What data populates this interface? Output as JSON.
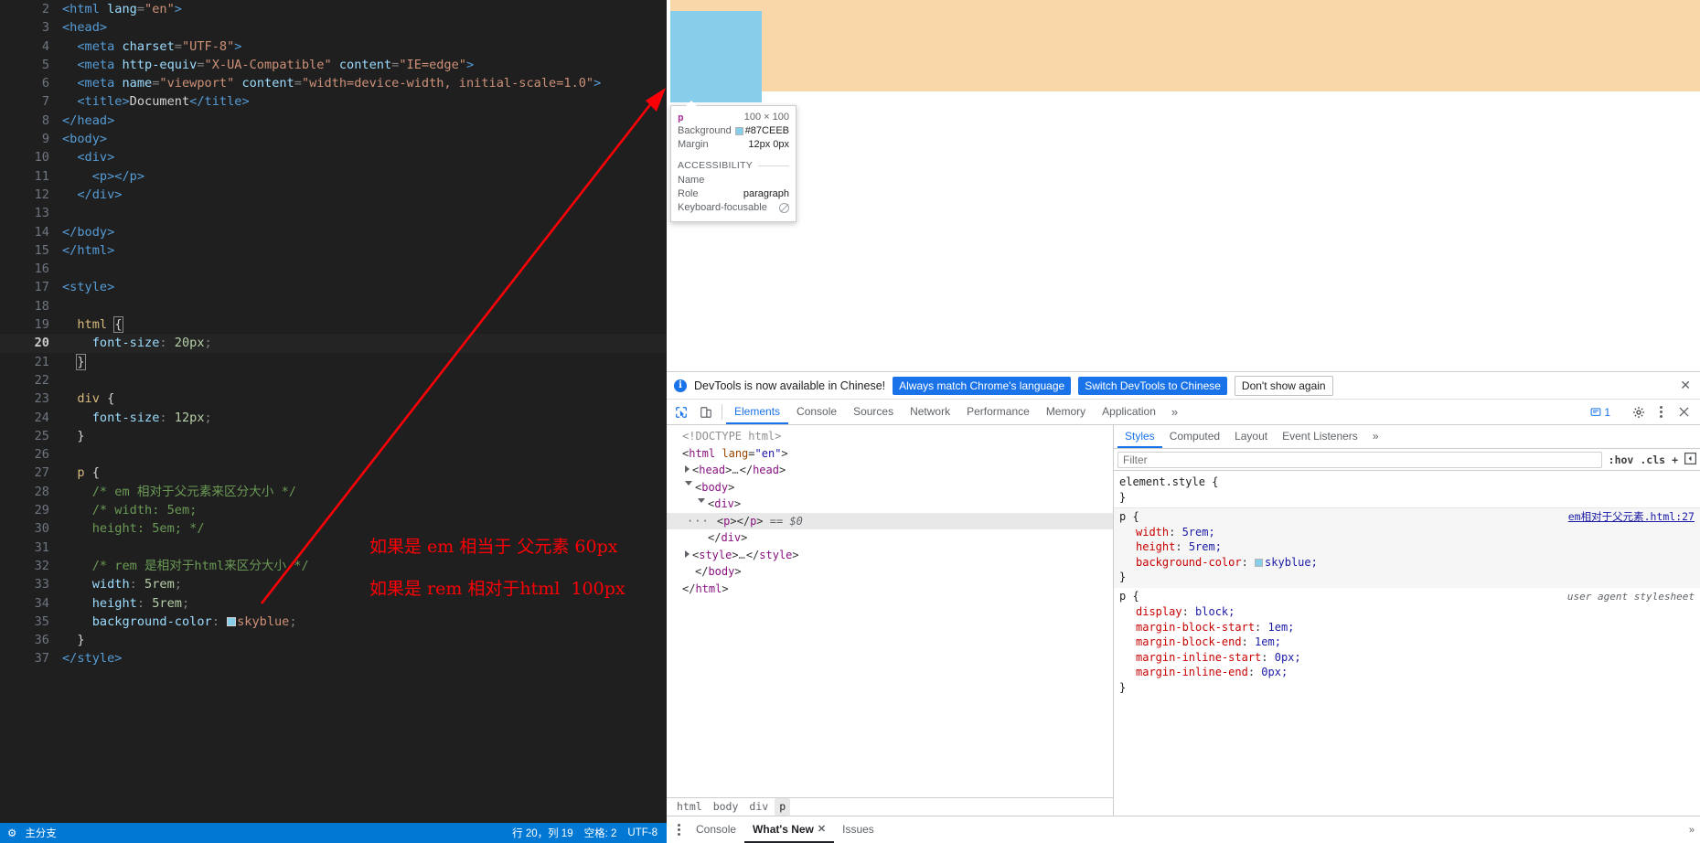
{
  "editor": {
    "lines": [
      {
        "n": 2,
        "tokens": [
          {
            "t": "tag",
            "v": "<html "
          },
          {
            "t": "attr",
            "v": "lang"
          },
          {
            "t": "punct",
            "v": "="
          },
          {
            "t": "str",
            "v": "\"en\""
          },
          {
            "t": "tag",
            "v": ">"
          }
        ]
      },
      {
        "n": 3,
        "tokens": [
          {
            "t": "tag",
            "v": "<head>"
          }
        ]
      },
      {
        "n": 4,
        "tokens": [
          {
            "t": "plain",
            "v": "  "
          },
          {
            "t": "tag",
            "v": "<meta "
          },
          {
            "t": "attr",
            "v": "charset"
          },
          {
            "t": "punct",
            "v": "="
          },
          {
            "t": "str",
            "v": "\"UTF-8\""
          },
          {
            "t": "tag",
            "v": ">"
          }
        ]
      },
      {
        "n": 5,
        "tokens": [
          {
            "t": "plain",
            "v": "  "
          },
          {
            "t": "tag",
            "v": "<meta "
          },
          {
            "t": "attr",
            "v": "http-equiv"
          },
          {
            "t": "punct",
            "v": "="
          },
          {
            "t": "str",
            "v": "\"X-UA-Compatible\""
          },
          {
            "t": "plain",
            "v": " "
          },
          {
            "t": "attr",
            "v": "content"
          },
          {
            "t": "punct",
            "v": "="
          },
          {
            "t": "str",
            "v": "\"IE=edge\""
          },
          {
            "t": "tag",
            "v": ">"
          }
        ]
      },
      {
        "n": 6,
        "tokens": [
          {
            "t": "plain",
            "v": "  "
          },
          {
            "t": "tag",
            "v": "<meta "
          },
          {
            "t": "attr",
            "v": "name"
          },
          {
            "t": "punct",
            "v": "="
          },
          {
            "t": "str",
            "v": "\"viewport\""
          },
          {
            "t": "plain",
            "v": " "
          },
          {
            "t": "attr",
            "v": "content"
          },
          {
            "t": "punct",
            "v": "="
          },
          {
            "t": "str",
            "v": "\"width=device-width, initial-scale=1.0\""
          },
          {
            "t": "tag",
            "v": ">"
          }
        ]
      },
      {
        "n": 7,
        "tokens": [
          {
            "t": "plain",
            "v": "  "
          },
          {
            "t": "tag",
            "v": "<title>"
          },
          {
            "t": "text",
            "v": "Document"
          },
          {
            "t": "tag",
            "v": "</title>"
          }
        ]
      },
      {
        "n": 8,
        "tokens": [
          {
            "t": "tag",
            "v": "</head>"
          }
        ]
      },
      {
        "n": 9,
        "tokens": [
          {
            "t": "tag",
            "v": "<body>"
          }
        ]
      },
      {
        "n": 10,
        "tokens": [
          {
            "t": "plain",
            "v": "  "
          },
          {
            "t": "tag",
            "v": "<div>"
          }
        ]
      },
      {
        "n": 11,
        "tokens": [
          {
            "t": "plain",
            "v": "    "
          },
          {
            "t": "tag",
            "v": "<p></p>"
          }
        ]
      },
      {
        "n": 12,
        "tokens": [
          {
            "t": "plain",
            "v": "  "
          },
          {
            "t": "tag",
            "v": "</div>"
          }
        ]
      },
      {
        "n": 13,
        "tokens": []
      },
      {
        "n": 14,
        "tokens": [
          {
            "t": "tag",
            "v": "</body>"
          }
        ]
      },
      {
        "n": 15,
        "tokens": [
          {
            "t": "tag",
            "v": "</html>"
          }
        ]
      },
      {
        "n": 16,
        "tokens": []
      },
      {
        "n": 17,
        "tokens": [
          {
            "t": "tag",
            "v": "<style>"
          }
        ]
      },
      {
        "n": 18,
        "tokens": []
      },
      {
        "n": 19,
        "tokens": [
          {
            "t": "plain",
            "v": "  "
          },
          {
            "t": "sel",
            "v": "html"
          },
          {
            "t": "plain",
            "v": " "
          },
          {
            "t": "brace-box",
            "v": "{"
          }
        ]
      },
      {
        "n": 20,
        "tokens": [
          {
            "t": "plain",
            "v": "    "
          },
          {
            "t": "prop",
            "v": "font-size"
          },
          {
            "t": "punct2",
            "v": ": "
          },
          {
            "t": "val",
            "v": "20px"
          },
          {
            "t": "punct2",
            "v": ";"
          }
        ],
        "active": true
      },
      {
        "n": 21,
        "tokens": [
          {
            "t": "plain",
            "v": "  "
          },
          {
            "t": "brace-box",
            "v": "}"
          }
        ]
      },
      {
        "n": 22,
        "tokens": []
      },
      {
        "n": 23,
        "tokens": [
          {
            "t": "plain",
            "v": "  "
          },
          {
            "t": "sel",
            "v": "div"
          },
          {
            "t": "plain",
            "v": " "
          },
          {
            "t": "brace",
            "v": "{"
          }
        ]
      },
      {
        "n": 24,
        "tokens": [
          {
            "t": "plain",
            "v": "    "
          },
          {
            "t": "prop",
            "v": "font-size"
          },
          {
            "t": "punct2",
            "v": ": "
          },
          {
            "t": "val",
            "v": "12px"
          },
          {
            "t": "punct2",
            "v": ";"
          }
        ]
      },
      {
        "n": 25,
        "tokens": [
          {
            "t": "plain",
            "v": "  "
          },
          {
            "t": "brace",
            "v": "}"
          }
        ]
      },
      {
        "n": 26,
        "tokens": []
      },
      {
        "n": 27,
        "tokens": [
          {
            "t": "plain",
            "v": "  "
          },
          {
            "t": "sel",
            "v": "p"
          },
          {
            "t": "plain",
            "v": " "
          },
          {
            "t": "brace",
            "v": "{"
          }
        ]
      },
      {
        "n": 28,
        "tokens": [
          {
            "t": "plain",
            "v": "    "
          },
          {
            "t": "com",
            "v": "/* em 相对于父元素来区分大小 */"
          }
        ]
      },
      {
        "n": 29,
        "tokens": [
          {
            "t": "plain",
            "v": "    "
          },
          {
            "t": "com",
            "v": "/* width: 5em;"
          }
        ]
      },
      {
        "n": 30,
        "tokens": [
          {
            "t": "plain",
            "v": "    "
          },
          {
            "t": "com",
            "v": "height: 5em; */"
          }
        ]
      },
      {
        "n": 31,
        "tokens": []
      },
      {
        "n": 32,
        "tokens": [
          {
            "t": "plain",
            "v": "    "
          },
          {
            "t": "com",
            "v": "/* rem 是相对于html来区分大小 */"
          }
        ]
      },
      {
        "n": 33,
        "tokens": [
          {
            "t": "plain",
            "v": "    "
          },
          {
            "t": "prop",
            "v": "width"
          },
          {
            "t": "punct2",
            "v": ": "
          },
          {
            "t": "val",
            "v": "5rem"
          },
          {
            "t": "punct2",
            "v": ";"
          }
        ]
      },
      {
        "n": 34,
        "tokens": [
          {
            "t": "plain",
            "v": "    "
          },
          {
            "t": "prop",
            "v": "height"
          },
          {
            "t": "punct2",
            "v": ": "
          },
          {
            "t": "val",
            "v": "5rem"
          },
          {
            "t": "punct2",
            "v": ";"
          }
        ]
      },
      {
        "n": 35,
        "tokens": [
          {
            "t": "plain",
            "v": "    "
          },
          {
            "t": "prop",
            "v": "background-color"
          },
          {
            "t": "punct2",
            "v": ": "
          },
          {
            "t": "swatch",
            "v": ""
          },
          {
            "t": "str",
            "v": "skyblue"
          },
          {
            "t": "punct2",
            "v": ";"
          }
        ]
      },
      {
        "n": 36,
        "tokens": [
          {
            "t": "plain",
            "v": "  "
          },
          {
            "t": "brace",
            "v": "}"
          }
        ]
      },
      {
        "n": 37,
        "tokens": [
          {
            "t": "tag",
            "v": "</style>"
          }
        ]
      }
    ],
    "annotations": [
      {
        "id": "annot1",
        "text": "如果是 em 相当于 父元素 60px"
      },
      {
        "id": "annot2",
        "text": "如果是 rem 相对于html  100px"
      }
    ],
    "statusbar": {
      "left": [
        "⚙",
        "主分支"
      ],
      "right": [
        "行 20，列 19",
        "空格: 2",
        "UTF-8"
      ]
    }
  },
  "browser": {
    "page": {
      "div_bg_color": "#fad7a9",
      "p_bg_color": "#87ceeb"
    },
    "inspect_tooltip": {
      "tag": "p",
      "dimensions": "100 × 100",
      "rows": [
        {
          "label": "Background",
          "value": "#87CEEB",
          "swatch": true
        },
        {
          "label": "Margin",
          "value": "12px 0px",
          "swatch": false
        }
      ],
      "section_title": "ACCESSIBILITY",
      "a11y": [
        {
          "label": "Name",
          "value": ""
        },
        {
          "label": "Role",
          "value": "paragraph"
        },
        {
          "label": "Keyboard-focusable",
          "value": "",
          "icon": "no-entry-icon"
        }
      ]
    }
  },
  "devtools": {
    "notice": {
      "message": "DevTools is now available in Chinese!",
      "btn_always": "Always match Chrome's language",
      "btn_switch": "Switch DevTools to Chinese",
      "btn_dismiss": "Don't show again",
      "close": "✕"
    },
    "tabs": [
      {
        "label": "Elements",
        "selected": true
      },
      {
        "label": "Console",
        "selected": false
      },
      {
        "label": "Sources",
        "selected": false
      },
      {
        "label": "Network",
        "selected": false
      },
      {
        "label": "Performance",
        "selected": false
      },
      {
        "label": "Memory",
        "selected": false
      },
      {
        "label": "Application",
        "selected": false
      }
    ],
    "tabs_overflow": "»",
    "message_count": "1",
    "dom": [
      {
        "indent": 0,
        "marker": "none",
        "tokens": [
          {
            "t": "doctype",
            "v": "<!DOCTYPE html>"
          }
        ]
      },
      {
        "indent": 0,
        "marker": "none",
        "tokens": [
          {
            "t": "punct",
            "v": "<"
          },
          {
            "t": "tag",
            "v": "html"
          },
          {
            "t": "plain",
            "v": " "
          },
          {
            "t": "attr",
            "v": "lang"
          },
          {
            "t": "punct",
            "v": "="
          },
          {
            "t": "val",
            "v": "\"en\""
          },
          {
            "t": "punct",
            "v": ">"
          }
        ]
      },
      {
        "indent": 1,
        "marker": "closed",
        "tokens": [
          {
            "t": "punct",
            "v": "<"
          },
          {
            "t": "tag",
            "v": "head"
          },
          {
            "t": "punct",
            "v": ">"
          },
          {
            "t": "dots",
            "v": "…"
          },
          {
            "t": "punct",
            "v": "</"
          },
          {
            "t": "tag",
            "v": "head"
          },
          {
            "t": "punct",
            "v": ">"
          }
        ]
      },
      {
        "indent": 1,
        "marker": "open",
        "tokens": [
          {
            "t": "punct",
            "v": "<"
          },
          {
            "t": "tag",
            "v": "body"
          },
          {
            "t": "punct",
            "v": ">"
          }
        ]
      },
      {
        "indent": 2,
        "marker": "open",
        "tokens": [
          {
            "t": "punct",
            "v": "<"
          },
          {
            "t": "tag",
            "v": "div"
          },
          {
            "t": "punct",
            "v": ">"
          }
        ]
      },
      {
        "indent": 3,
        "marker": "dots",
        "selected": true,
        "tokens": [
          {
            "t": "punct",
            "v": "<"
          },
          {
            "t": "tag",
            "v": "p"
          },
          {
            "t": "punct",
            "v": "></"
          },
          {
            "t": "tag",
            "v": "p"
          },
          {
            "t": "punct",
            "v": ">"
          },
          {
            "t": "plain",
            "v": " "
          },
          {
            "t": "dollar",
            "v": "== $0"
          }
        ]
      },
      {
        "indent": 2,
        "marker": "none",
        "tokens": [
          {
            "t": "punct",
            "v": "</"
          },
          {
            "t": "tag",
            "v": "div"
          },
          {
            "t": "punct",
            "v": ">"
          }
        ]
      },
      {
        "indent": 1,
        "marker": "closed",
        "tokens": [
          {
            "t": "punct",
            "v": "<"
          },
          {
            "t": "tag",
            "v": "style"
          },
          {
            "t": "punct",
            "v": ">"
          },
          {
            "t": "dots",
            "v": "…"
          },
          {
            "t": "punct",
            "v": "</"
          },
          {
            "t": "tag",
            "v": "style"
          },
          {
            "t": "punct",
            "v": ">"
          }
        ]
      },
      {
        "indent": 1,
        "marker": "none",
        "tokens": [
          {
            "t": "punct",
            "v": "</"
          },
          {
            "t": "tag",
            "v": "body"
          },
          {
            "t": "punct",
            "v": ">"
          }
        ]
      },
      {
        "indent": 0,
        "marker": "none",
        "tokens": [
          {
            "t": "punct",
            "v": "</"
          },
          {
            "t": "tag",
            "v": "html"
          },
          {
            "t": "punct",
            "v": ">"
          }
        ]
      }
    ],
    "breadcrumb": [
      "html",
      "body",
      "div",
      "p"
    ],
    "breadcrumb_selected": "p",
    "styles": {
      "tabs": [
        {
          "label": "Styles",
          "selected": true
        },
        {
          "label": "Computed",
          "selected": false
        },
        {
          "label": "Layout",
          "selected": false
        },
        {
          "label": "Event Listeners",
          "selected": false
        }
      ],
      "tabs_overflow": "»",
      "filter_placeholder": "Filter",
      "filter_value": "",
      "toolbar": [
        ":hov",
        ".cls",
        "+"
      ],
      "rules": [
        {
          "selector": "element.style {",
          "source": "",
          "declarations": [],
          "close": "}"
        },
        {
          "selector": "p {",
          "source": "em相对于父元素.html:27",
          "source_is_link": true,
          "highlight": true,
          "declarations": [
            {
              "name": "width",
              "value": "5rem;"
            },
            {
              "name": "height",
              "value": "5rem;"
            },
            {
              "name": "background-color",
              "value": "skyblue;",
              "swatch": true
            }
          ],
          "close": "}"
        },
        {
          "selector": "p {",
          "source": "user agent stylesheet",
          "source_is_link": false,
          "declarations": [
            {
              "name": "display",
              "value": "block;"
            },
            {
              "name": "margin-block-start",
              "value": "1em;"
            },
            {
              "name": "margin-block-end",
              "value": "1em;"
            },
            {
              "name": "margin-inline-start",
              "value": "0px;"
            },
            {
              "name": "margin-inline-end",
              "value": "0px;"
            }
          ],
          "close": "}"
        }
      ]
    },
    "drawer": {
      "tabs": [
        {
          "label": "Console",
          "selected": false,
          "closable": false
        },
        {
          "label": "What's New",
          "selected": true,
          "closable": true
        },
        {
          "label": "Issues",
          "selected": false,
          "closable": false
        }
      ],
      "overflow": "»"
    }
  }
}
